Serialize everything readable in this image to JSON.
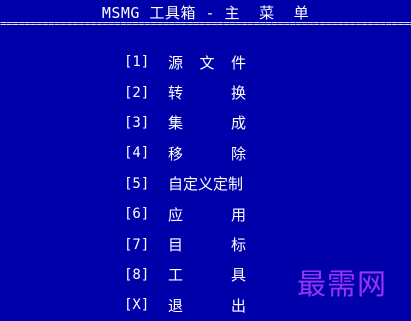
{
  "title": "MSMG 工具箱 - 主  菜  单",
  "separator": "=========================================================================",
  "menu": {
    "items": [
      {
        "key": "[1]",
        "label_chars": [
          "源",
          "文",
          "件"
        ]
      },
      {
        "key": "[2]",
        "label_chars": [
          "转",
          "换"
        ]
      },
      {
        "key": "[3]",
        "label_chars": [
          "集",
          "成"
        ]
      },
      {
        "key": "[4]",
        "label_chars": [
          "移",
          "除"
        ]
      },
      {
        "key": "[5]",
        "label": "自定义定制"
      },
      {
        "key": "[6]",
        "label_chars": [
          "应",
          "用"
        ]
      },
      {
        "key": "[7]",
        "label_chars": [
          "目",
          "标"
        ]
      },
      {
        "key": "[8]",
        "label_chars": [
          "工",
          "具"
        ]
      },
      {
        "key": "[X]",
        "label_chars": [
          "退",
          "出"
        ]
      }
    ]
  },
  "watermark": "最需网",
  "colors": {
    "background": "#0000aa",
    "text": "#ffffff",
    "watermark": "#b23cff"
  }
}
